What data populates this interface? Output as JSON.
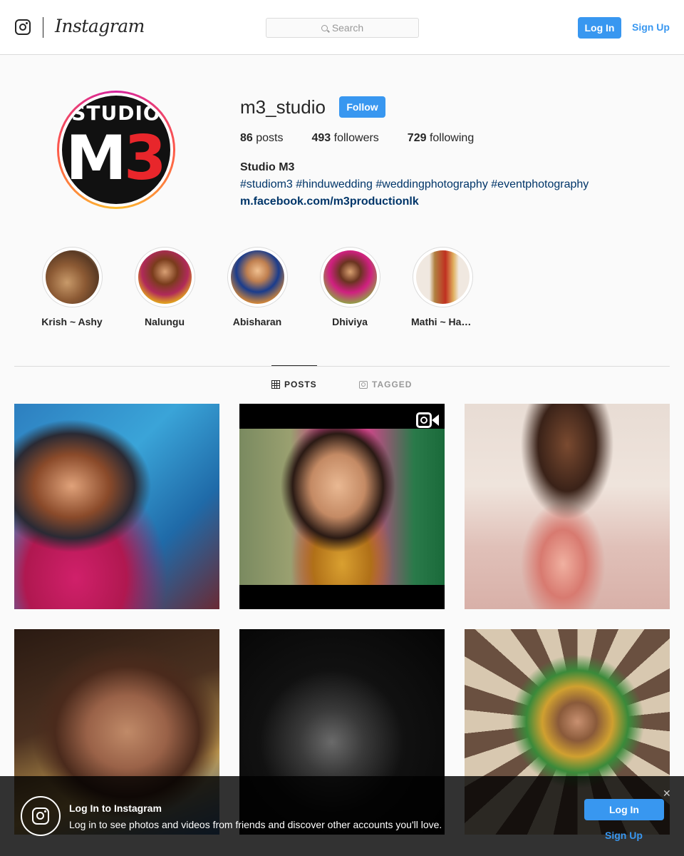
{
  "header": {
    "brand": "Instagram",
    "search_placeholder": "Search",
    "login_label": "Log In",
    "signup_label": "Sign Up"
  },
  "profile": {
    "username": "m3_studio",
    "follow_label": "Follow",
    "avatar_text_top": "STUDIO",
    "avatar_text_m": "M",
    "avatar_text_3": "3",
    "stats": [
      {
        "count": "86",
        "label": "posts"
      },
      {
        "count": "493",
        "label": "followers"
      },
      {
        "count": "729",
        "label": "following"
      }
    ],
    "full_name": "Studio M3",
    "bio": "#studiom3 #hinduwedding #weddingphotography #eventphotography",
    "link": "m.facebook.com/m3productionlk"
  },
  "highlights": [
    {
      "label": "Krish ~ Ashy"
    },
    {
      "label": "Nalungu"
    },
    {
      "label": "Abisharan"
    },
    {
      "label": "Dhiviya"
    },
    {
      "label": "Mathi ~ Harini"
    }
  ],
  "tabs": [
    {
      "label": "POSTS"
    },
    {
      "label": "TAGGED"
    }
  ],
  "colors": {
    "accent": "#3897f0",
    "link": "#003569",
    "text": "#262626",
    "border": "#dbdbdb"
  },
  "banner": {
    "title": "Log In to Instagram",
    "subtitle": "Log in to see photos and videos from friends and discover other accounts you'll love.",
    "login_label": "Log In",
    "signup_label": "Sign Up",
    "close_glyph": "✕"
  }
}
